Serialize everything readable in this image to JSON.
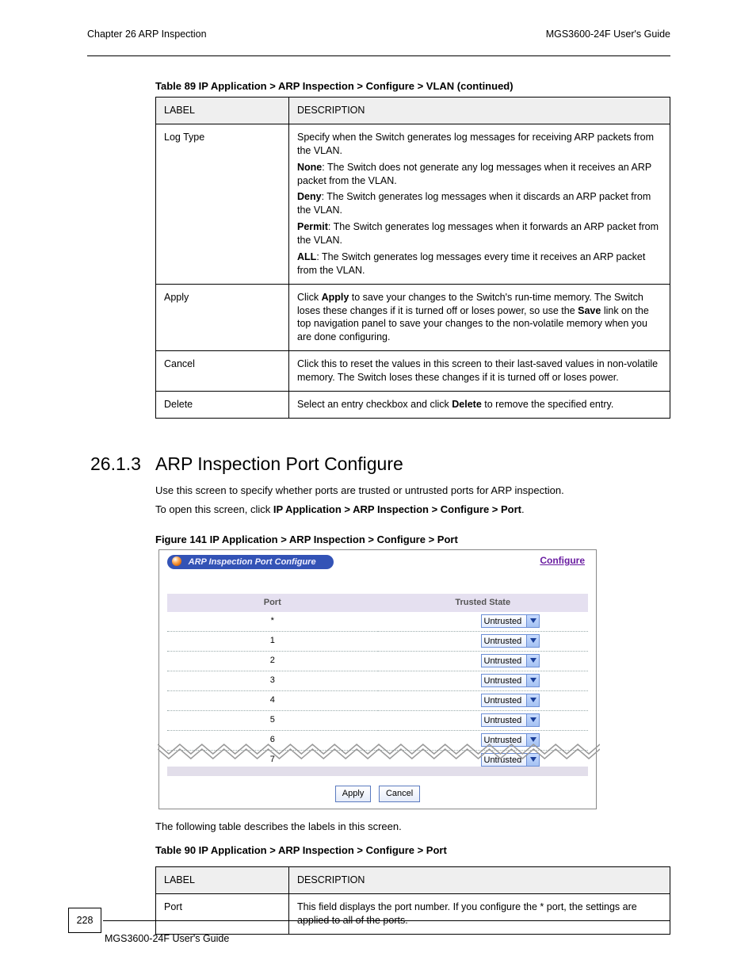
{
  "header": {
    "chapter": "Chapter 26 ARP Inspection",
    "guide": "MGS3600-24F User's Guide"
  },
  "table": {
    "caption": "Table 89   IP Application > ARP Inspection > Configure > VLAN (continued)",
    "head": {
      "col1": "LABEL",
      "col2": "DESCRIPTION"
    },
    "rows": [
      {
        "label": "Log Type",
        "body1": "Specify when the Switch generates log messages for receiving ARP packets from the VLAN.",
        "sub": [
          {
            "k": "None",
            "v": ": The Switch does not generate any log messages when it receives an ARP packet from the VLAN."
          },
          {
            "k": "Deny",
            "v": ": The Switch generates log messages when it discards an ARP packet from the VLAN."
          },
          {
            "k": "Permit",
            "v": ": The Switch generates log messages when it forwards an ARP packet from the VLAN."
          },
          {
            "k": "ALL",
            "v": ": The Switch generates log messages every time it receives an ARP packet from the VLAN."
          }
        ]
      },
      {
        "label": "Apply",
        "body1": "Click Apply to save your changes to the Switch's run-time memory. The Switch loses these changes if it is turned off or loses power, so use the Save link on the top navigation panel to save your changes to the non-volatile memory when you are done configuring.",
        "boldwords": [
          "Apply",
          "Save"
        ]
      },
      {
        "label": "Cancel",
        "body1": "Click this to reset the values in this screen to their last-saved values in non-volatile memory. The Switch loses these changes if it is turned off or loses power."
      },
      {
        "label": "Delete",
        "body1": "Select an entry checkbox and click Delete to remove the specified entry.",
        "boldwords": [
          "Delete"
        ]
      }
    ]
  },
  "section": {
    "num": "26.1.3",
    "title": "ARP Inspection Port Configure",
    "body1": "Use this screen to specify whether ports are trusted or untrusted ports for ARP inspection.",
    "body2a": "To open this screen, click ",
    "path": "IP Application > ARP Inspection > Configure > Port",
    "body2b": "."
  },
  "figure": {
    "caption": "Figure 141   IP Application > ARP Inspection > Configure > Port",
    "pill_title": "ARP Inspection Port Configure",
    "configure_link": "Configure",
    "thead": {
      "port": "Port",
      "state": "Trusted State"
    },
    "select_label": "Untrusted",
    "rows": [
      "*",
      "1",
      "2",
      "3",
      "4",
      "5",
      "6",
      "7"
    ],
    "apply": "Apply",
    "cancel": "Cancel"
  },
  "after": {
    "p1": "The following table describes the labels in this screen.",
    "cap2": "Table 90   IP Application > ARP Inspection > Configure > Port",
    "th1": "LABEL",
    "th2": "DESCRIPTION",
    "row1_label": "Port",
    "row1_desc": "This field displays the port number. If you configure the * port, the settings are applied to all of the ports."
  },
  "footer": {
    "pagenum": "228",
    "text": "MGS3600-24F User's Guide"
  }
}
